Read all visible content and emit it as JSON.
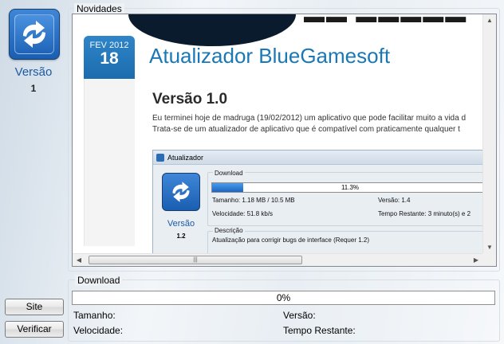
{
  "sidebar": {
    "title": "Versão",
    "number": "1",
    "site_button": "Site",
    "verify_button": "Verificar"
  },
  "news": {
    "group_title": "Novidades",
    "date_month": "FEV 2012",
    "date_day": "18",
    "post_title": "Atualizador BlueGamesoft",
    "version_heading": "Versão 1.0",
    "paragraph_1": "Eu terminei hoje de madruga (19/02/2012) um aplicativo que pode facilitar muito a vida d",
    "paragraph_2": "Trata-se de um atualizador de aplicativo que é compatível com praticamente qualquer t",
    "screenshot": {
      "window_title": "Atualizador",
      "download_title": "Download",
      "progress_percent": 11.3,
      "progress_text": "11.3%",
      "size_text": "Tamanho: 1.18 MB / 10.5 MB",
      "version_text": "Versão: 1.4",
      "speed_text": "Velocidade: 51.8 kb/s",
      "time_text": "Tempo Restante: 3 minuto(s) e 2",
      "logo_label": "Versão",
      "logo_number": "1.2",
      "description_title": "Descrição",
      "description_text": "Atualização para corrigir bugs de interface (Requer 1.2)"
    }
  },
  "download": {
    "group_title": "Download",
    "progress_percent": 0,
    "progress_text": "0%",
    "size_label": "Tamanho:",
    "speed_label": "Velocidade:",
    "version_label": "Versão:",
    "time_label": "Tempo Restante:"
  }
}
